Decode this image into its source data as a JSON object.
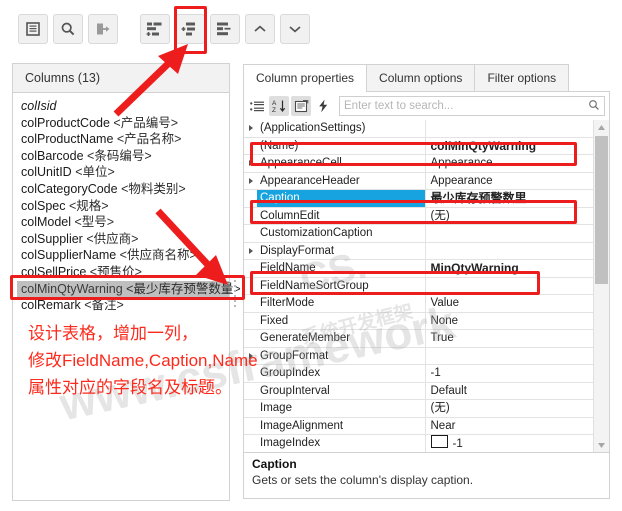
{
  "toolbar": {
    "buttons": [
      {
        "name": "list-view-icon",
        "label": "List view"
      },
      {
        "name": "search-icon",
        "label": "Search"
      },
      {
        "name": "exit-icon",
        "label": "Exit"
      },
      {
        "name": "add-column-icon",
        "label": "Add column"
      },
      {
        "name": "insert-column-icon",
        "label": "Insert column"
      },
      {
        "name": "remove-column-icon",
        "label": "Remove column"
      },
      {
        "name": "move-up-icon",
        "label": "Move up"
      },
      {
        "name": "move-down-icon",
        "label": "Move down"
      }
    ]
  },
  "left_panel": {
    "header": "Columns (13)",
    "items": [
      {
        "name": "colIsid",
        "caption": "",
        "italic": true,
        "selected": false
      },
      {
        "name": "colProductCode",
        "caption": "<产品编号>",
        "italic": false,
        "selected": false
      },
      {
        "name": "colProductName",
        "caption": "<产品名称>",
        "italic": false,
        "selected": false
      },
      {
        "name": "colBarcode",
        "caption": "<条码编号>",
        "italic": false,
        "selected": false
      },
      {
        "name": "colUnitID",
        "caption": "<单位>",
        "italic": false,
        "selected": false
      },
      {
        "name": "colCategoryCode",
        "caption": "<物料类别>",
        "italic": false,
        "selected": false
      },
      {
        "name": "colSpec",
        "caption": "<规格>",
        "italic": false,
        "selected": false
      },
      {
        "name": "colModel",
        "caption": "<型号>",
        "italic": false,
        "selected": false
      },
      {
        "name": "colSupplier",
        "caption": "<供应商>",
        "italic": false,
        "selected": false
      },
      {
        "name": "colSupplierName",
        "caption": "<供应商名称>",
        "italic": false,
        "selected": false
      },
      {
        "name": "colSellPrice",
        "caption": "<预售价>",
        "italic": false,
        "selected": false
      },
      {
        "name": "colMinQtyWarning",
        "caption": "<最少库存预警数量>",
        "italic": false,
        "selected": true
      },
      {
        "name": "colRemark",
        "caption": "<备注>",
        "italic": false,
        "selected": false
      }
    ]
  },
  "right_panel": {
    "tabs": [
      {
        "label": "Column properties",
        "active": true
      },
      {
        "label": "Column options",
        "active": false
      },
      {
        "label": "Filter options",
        "active": false
      }
    ],
    "grid_toolbar": {
      "categorized_icon": "categorized-icon",
      "sort_az_icon": "sort-alphabetical-icon",
      "properties_icon": "properties-page-icon",
      "events_icon": "events-lightning-icon",
      "search_placeholder": "Enter text to search...",
      "search_value": "",
      "search_icon": "magnifier-icon"
    },
    "properties": [
      {
        "name": "(ApplicationSettings)",
        "value": "",
        "expandable": true,
        "selected": false,
        "bold": false
      },
      {
        "name": "(Name)",
        "value": "colMinQtyWarning",
        "expandable": false,
        "selected": false,
        "bold": true
      },
      {
        "name": "AppearanceCell",
        "value": "Appearance",
        "expandable": true,
        "selected": false,
        "bold": false
      },
      {
        "name": "AppearanceHeader",
        "value": "Appearance",
        "expandable": true,
        "selected": false,
        "bold": false
      },
      {
        "name": "Caption",
        "value": "最少库存预警数里",
        "expandable": false,
        "selected": true,
        "bold": true
      },
      {
        "name": "ColumnEdit",
        "value": "(无)",
        "expandable": false,
        "selected": false,
        "bold": false
      },
      {
        "name": "CustomizationCaption",
        "value": "",
        "expandable": false,
        "selected": false,
        "bold": false
      },
      {
        "name": "DisplayFormat",
        "value": "",
        "expandable": true,
        "selected": false,
        "bold": false
      },
      {
        "name": "FieldName",
        "value": "MinQtyWarning",
        "expandable": false,
        "selected": false,
        "bold": true
      },
      {
        "name": "FieldNameSortGroup",
        "value": "",
        "expandable": false,
        "selected": false,
        "bold": false
      },
      {
        "name": "FilterMode",
        "value": "Value",
        "expandable": false,
        "selected": false,
        "bold": false
      },
      {
        "name": "Fixed",
        "value": "None",
        "expandable": false,
        "selected": false,
        "bold": false
      },
      {
        "name": "GenerateMember",
        "value": "True",
        "expandable": false,
        "selected": false,
        "bold": false
      },
      {
        "name": "GroupFormat",
        "value": "",
        "expandable": true,
        "selected": false,
        "bold": false
      },
      {
        "name": "GroupIndex",
        "value": "-1",
        "expandable": false,
        "selected": false,
        "bold": false
      },
      {
        "name": "GroupInterval",
        "value": "Default",
        "expandable": false,
        "selected": false,
        "bold": false
      },
      {
        "name": "Image",
        "value": "(无)",
        "expandable": false,
        "selected": false,
        "bold": false
      },
      {
        "name": "ImageAlignment",
        "value": "Near",
        "expandable": false,
        "selected": false,
        "bold": false
      },
      {
        "name": "ImageIndex",
        "value": "-1",
        "expandable": false,
        "selected": false,
        "bold": false,
        "swatch": true
      }
    ],
    "description": {
      "title": "Caption",
      "text": "Gets or sets the column's display caption."
    }
  },
  "annotation": {
    "lines": [
      "设计表格，增加一列，",
      "修改FieldName,Caption,Name",
      "属性对应的字段名及标题。"
    ],
    "color": "#fc2a1c"
  },
  "watermark": {
    "main": "www.csframework",
    "sub1": "CS.",
    "sub2": "系统开发框架"
  },
  "colors": {
    "selection_blue": "#17a3df",
    "annotation_red": "#ee1d1d",
    "list_selection_gray": "#bfbfbf"
  }
}
